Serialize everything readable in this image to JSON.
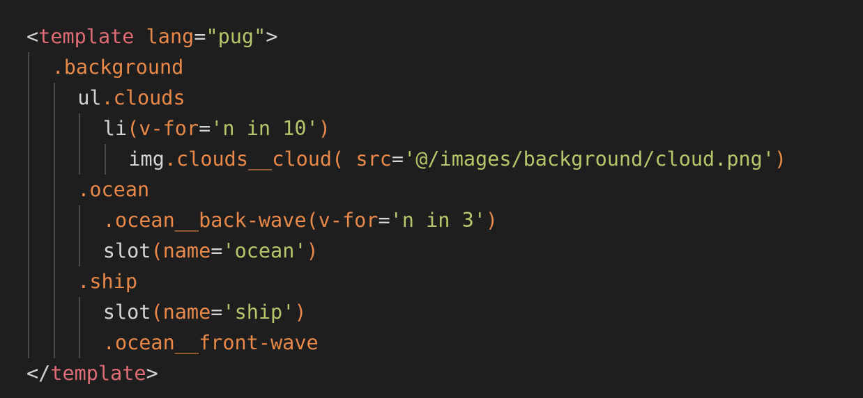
{
  "editor": {
    "language": "pug",
    "colors": {
      "background": "#1e1e1e",
      "punctuation": "#d4d4d4",
      "tag": "#e06c75",
      "attribute": "#e8894a",
      "string": "#b5c76b",
      "indent_guide": "#4a4a4a"
    },
    "lines": [
      {
        "indent": 0,
        "tokens": [
          {
            "t": "punc",
            "v": "<"
          },
          {
            "t": "tag",
            "v": "template"
          },
          {
            "t": "text",
            "v": " "
          },
          {
            "t": "attr",
            "v": "lang"
          },
          {
            "t": "punc",
            "v": "="
          },
          {
            "t": "str",
            "v": "\"pug\""
          },
          {
            "t": "punc",
            "v": ">"
          }
        ]
      },
      {
        "indent": 1,
        "tokens": [
          {
            "t": "attr",
            "v": ".background"
          }
        ]
      },
      {
        "indent": 2,
        "tokens": [
          {
            "t": "text",
            "v": "ul"
          },
          {
            "t": "attr",
            "v": ".clouds"
          }
        ]
      },
      {
        "indent": 3,
        "tokens": [
          {
            "t": "text",
            "v": "li"
          },
          {
            "t": "attr",
            "v": "(v-for"
          },
          {
            "t": "punc",
            "v": "="
          },
          {
            "t": "str",
            "v": "'n in 10'"
          },
          {
            "t": "attr",
            "v": ")"
          }
        ]
      },
      {
        "indent": 4,
        "tokens": [
          {
            "t": "text",
            "v": "img"
          },
          {
            "t": "attr",
            "v": ".clouds__cloud( src"
          },
          {
            "t": "punc",
            "v": "="
          },
          {
            "t": "str",
            "v": "'@/images/background/cloud.png'"
          },
          {
            "t": "attr",
            "v": ")"
          }
        ]
      },
      {
        "indent": 2,
        "tokens": [
          {
            "t": "attr",
            "v": ".ocean"
          }
        ]
      },
      {
        "indent": 3,
        "tokens": [
          {
            "t": "attr",
            "v": ".ocean__back-wave(v-for"
          },
          {
            "t": "punc",
            "v": "="
          },
          {
            "t": "str",
            "v": "'n in 3'"
          },
          {
            "t": "attr",
            "v": ")"
          }
        ]
      },
      {
        "indent": 3,
        "tokens": [
          {
            "t": "text",
            "v": "slot"
          },
          {
            "t": "attr",
            "v": "(name"
          },
          {
            "t": "punc",
            "v": "="
          },
          {
            "t": "str",
            "v": "'ocean'"
          },
          {
            "t": "attr",
            "v": ")"
          }
        ]
      },
      {
        "indent": 2,
        "tokens": [
          {
            "t": "attr",
            "v": ".ship"
          }
        ]
      },
      {
        "indent": 3,
        "tokens": [
          {
            "t": "text",
            "v": "slot"
          },
          {
            "t": "attr",
            "v": "(name"
          },
          {
            "t": "punc",
            "v": "="
          },
          {
            "t": "str",
            "v": "'ship'"
          },
          {
            "t": "attr",
            "v": ")"
          }
        ]
      },
      {
        "indent": 3,
        "tokens": [
          {
            "t": "attr",
            "v": ".ocean__front-wave"
          }
        ]
      },
      {
        "indent": 0,
        "tokens": [
          {
            "t": "punc",
            "v": "</"
          },
          {
            "t": "tag",
            "v": "template"
          },
          {
            "t": "punc",
            "v": ">"
          }
        ]
      }
    ]
  }
}
